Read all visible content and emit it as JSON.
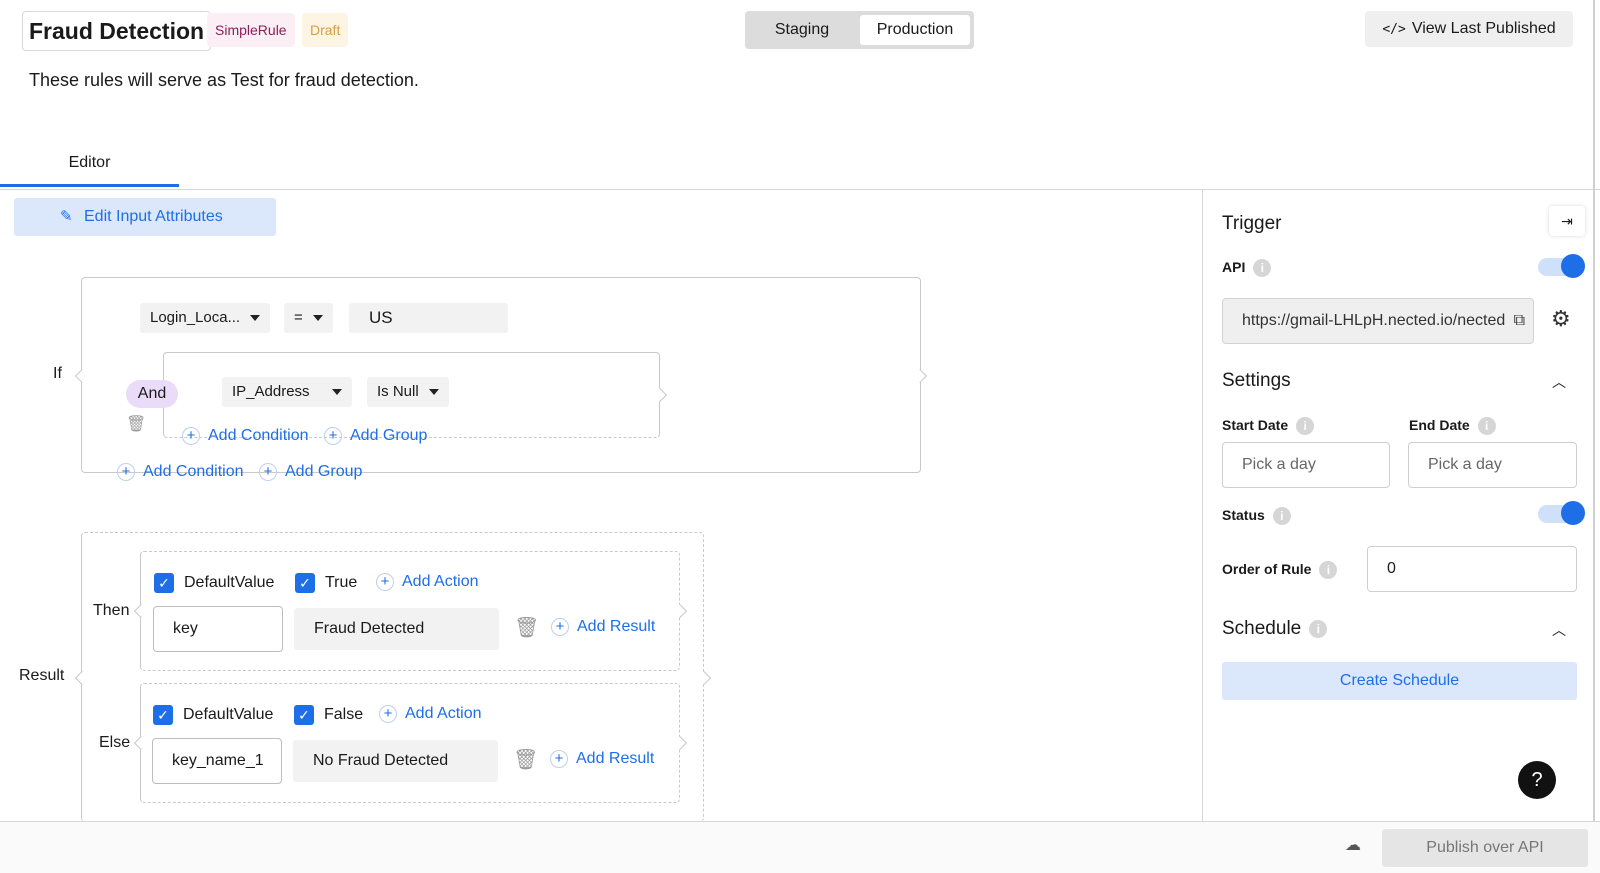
{
  "header": {
    "title": "Fraud Detection",
    "tags": {
      "type": "SimpleRule",
      "status": "Draft"
    },
    "environments": {
      "staging": "Staging",
      "production": "Production",
      "selected": "Production"
    },
    "view_last_published": "View Last Published",
    "code_icon": "</>",
    "description": "These rules will serve as Test for fraud detection."
  },
  "tabs": {
    "editor": "Editor"
  },
  "editor": {
    "edit_input_attributes": "Edit Input Attributes",
    "if_label": "If",
    "condition_1": {
      "attribute": "Login_Loca...",
      "operator": "=",
      "value": "US"
    },
    "group": {
      "connector": "And",
      "condition": {
        "attribute": "IP_Address",
        "operator": "Is Null"
      },
      "add_condition": "Add Condition",
      "add_group": "Add Group"
    },
    "add_condition": "Add Condition",
    "add_group": "Add Group",
    "result_label": "Result",
    "then": {
      "label": "Then",
      "default_value_label": "DefaultValue",
      "default_value_checked": true,
      "bool_label": "True",
      "bool_checked": true,
      "add_action": "Add Action",
      "key": "key",
      "value": "Fraud  Detected",
      "add_result": "Add Result"
    },
    "else": {
      "label": "Else",
      "default_value_label": "DefaultValue",
      "default_value_checked": true,
      "bool_label": "False",
      "bool_checked": true,
      "add_action": "Add Action",
      "key": "key_name_1",
      "value": "No Fraud Detected",
      "add_result": "Add Result"
    }
  },
  "panel": {
    "trigger_title": "Trigger",
    "api_label": "API",
    "api_enabled": true,
    "api_url": "https://gmail-LHLpH.nected.io/nected",
    "settings_title": "Settings",
    "start_date_label": "Start Date",
    "start_date_placeholder": "Pick a day",
    "end_date_label": "End Date",
    "end_date_placeholder": "Pick a day",
    "status_label": "Status",
    "status_enabled": true,
    "order_label": "Order of Rule",
    "order_value": "0",
    "schedule_title": "Schedule",
    "create_schedule": "Create Schedule"
  },
  "footer": {
    "publish": "Publish over API"
  },
  "help": "?",
  "colors": {
    "accent": "#1e6ee8",
    "accent_light": "#dbe8fb",
    "tag_simple_bg": "#fbeef5",
    "tag_draft_bg": "#fdf4e3",
    "and_pill": "#eadcf8"
  },
  "icons": {
    "pencil": "pencil-icon",
    "trash": "trash-icon",
    "plus": "plus-circle-icon",
    "check": "checkbox-checked-icon",
    "gear": "gear-icon",
    "copy": "copy-icon",
    "info": "info-icon",
    "chevron": "chevron-up-icon",
    "cloud": "cloud-icon",
    "collapse": "panel-collapse-icon"
  }
}
